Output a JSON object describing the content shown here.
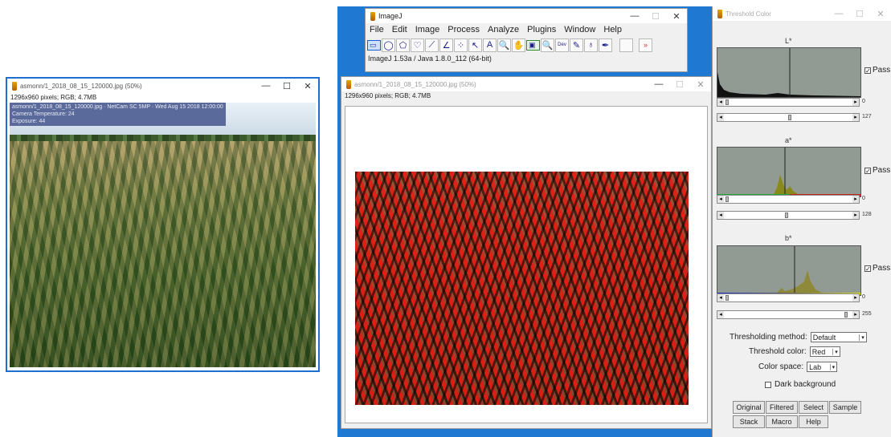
{
  "left_window": {
    "title": "asmonn/1_2018_08_15_120000.jpg (50%)",
    "info": "1296x960 pixels; RGB; 4.7MB",
    "overlay_lines": [
      "asmonn/1_2018_08_15_120000.jpg · NetCam SC 5MP · Wed Aug 15 2018 12:00:00",
      "Camera Temperature: 24",
      "Exposure: 44"
    ],
    "controls": [
      "—",
      "☐",
      "✕"
    ]
  },
  "imagej_main": {
    "title": "ImageJ",
    "menus": [
      "File",
      "Edit",
      "Image",
      "Process",
      "Analyze",
      "Plugins",
      "Window",
      "Help"
    ],
    "tools": [
      "▭",
      "◯",
      "⬠",
      "♡",
      "⟋",
      "∠",
      "⁘",
      "↖",
      "A",
      "🔍",
      "✋",
      "▣",
      "🔍",
      "Dev",
      "✎",
      "♁",
      "✒",
      "»"
    ],
    "status": "ImageJ 1.53a / Java 1.8.0_112 (64-bit)",
    "controls": [
      "—",
      "☐",
      "✕"
    ]
  },
  "center_window": {
    "title": "asmonn/1_2018_08_15_120000.jpg (50%)",
    "info": "1296x960 pixels; RGB; 4.7MB",
    "controls": [
      "—",
      "☐",
      "✕"
    ]
  },
  "threshold": {
    "title": "Threshold Color",
    "controls": [
      "—",
      "☐",
      "✕"
    ],
    "channels": [
      {
        "label": "L*",
        "pass_label": "Pass",
        "min_value": "0",
        "max_value": "127"
      },
      {
        "label": "a*",
        "pass_label": "Pass",
        "min_value": "0",
        "max_value": "128"
      },
      {
        "label": "b*",
        "pass_label": "Pass",
        "min_value": "0",
        "max_value": "255"
      }
    ],
    "method_label": "Thresholding method:",
    "method_value": "Default",
    "color_label": "Threshold color:",
    "color_value": "Red",
    "space_label": "Color space:",
    "space_value": "Lab",
    "dark_bg_label": "Dark background",
    "buttons": [
      "Original",
      "Filtered",
      "Select",
      "Sample",
      "Stack",
      "Macro",
      "Help"
    ]
  },
  "colors": {
    "active_border": "#1e6fd0",
    "threshold_red": "#e0231b",
    "hist_bg": "#929b93"
  }
}
